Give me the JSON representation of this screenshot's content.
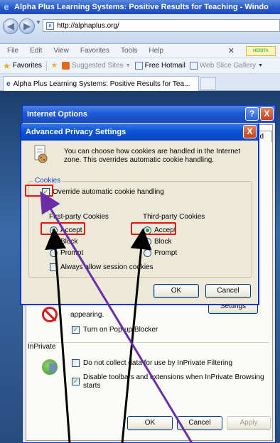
{
  "browser": {
    "window_title": "Alpha Plus Learning Systems: Positive Results for Teaching - Windo",
    "address": "http://alphaplus.org/",
    "menu": [
      "File",
      "Edit",
      "View",
      "Favorites",
      "Tools",
      "Help"
    ],
    "home_badge": "HERITA",
    "favorites_label": "Favorites",
    "favorites_items": [
      "Suggested Sites",
      "Free Hotmail",
      "Web Slice Gallery"
    ],
    "tab_title": "Alpha Plus Learning Systems: Positive Results for Tea..."
  },
  "internet_options": {
    "title": "Internet Options",
    "help_glyph": "?",
    "close_glyph": "X",
    "tab_fragment": "ed",
    "popup_text": "appearing.",
    "settings_button": "Settings",
    "turn_on_popup": "Turn on Pop-up Blocker",
    "inprivate_group": "InPrivate",
    "no_collect": "Do not collect data for use by InPrivate Filtering",
    "disable_toolbars_line1": "Disable toolbars and extensions when InPrivate Browsing",
    "disable_toolbars_line2": "starts",
    "ok": "OK",
    "cancel": "Cancel",
    "apply": "Apply"
  },
  "advanced_privacy": {
    "title": "Advanced Privacy Settings",
    "close_glyph": "X",
    "intro_line1": "You can choose how cookies are handled in the Internet",
    "intro_line2": "zone.  This overrides automatic cookie handling.",
    "cookies_group": "Cookies",
    "override_label": "Override automatic cookie handling",
    "override_checked": true,
    "first_party": {
      "header": "First-party Cookies",
      "options": [
        "Accept",
        "Block",
        "Prompt"
      ],
      "selected": "Accept"
    },
    "third_party": {
      "header": "Third-party Cookies",
      "options": [
        "Accept",
        "Block",
        "Prompt"
      ],
      "selected": "Accept"
    },
    "session_label": "Always allow session cookies",
    "session_checked": false,
    "ok": "OK",
    "cancel": "Cancel"
  },
  "colors": {
    "highlight": "#e81010",
    "arrow_black": "#000000",
    "arrow_purple": "#6a2ea8",
    "xp_title_blue": "#0a55d8"
  }
}
